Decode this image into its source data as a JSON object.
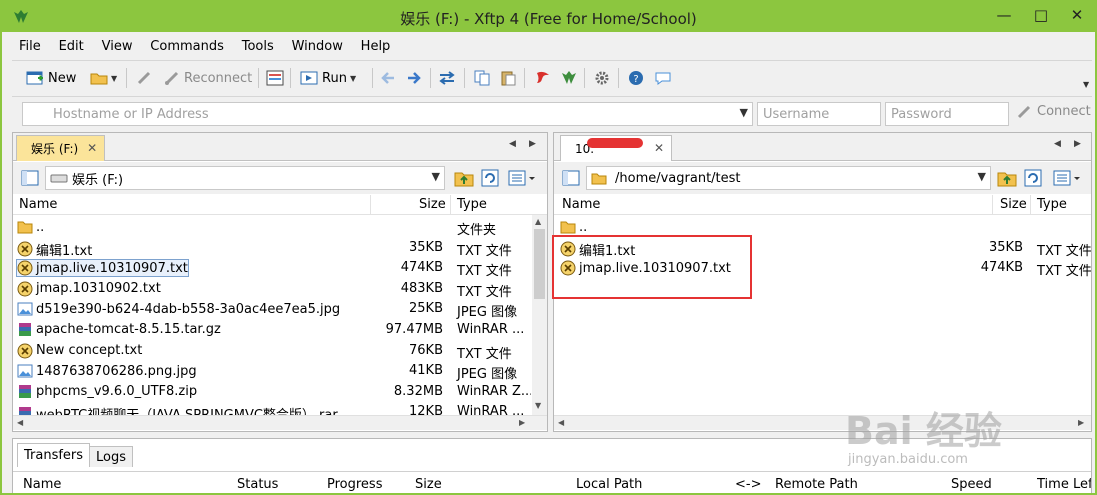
{
  "window": {
    "title": "娱乐 (F:) - Xftp 4 (Free for Home/School)",
    "minimize": "—",
    "maximize": "□",
    "close": "✕"
  },
  "menu": [
    "File",
    "Edit",
    "View",
    "Commands",
    "Tools",
    "Window",
    "Help"
  ],
  "toolbar": {
    "new_label": "New",
    "reconnect_label": "Reconnect",
    "run_label": "Run"
  },
  "address": {
    "host_placeholder": "Hostname or IP Address",
    "username_placeholder": "Username",
    "password_placeholder": "Password",
    "connect_label": "Connect"
  },
  "local": {
    "tab_label": "娱乐 (F:)",
    "path": "娱乐 (F:)",
    "columns": {
      "name": "Name",
      "size": "Size",
      "type": "Type"
    },
    "files": [
      {
        "name": "..",
        "size": "",
        "type": "文件夹",
        "icon": "folder-icon"
      },
      {
        "name": "编辑1.txt",
        "size": "35KB",
        "type": "TXT 文件",
        "icon": "txt-file-icon"
      },
      {
        "name": "jmap.live.10310907.txt",
        "size": "474KB",
        "type": "TXT 文件",
        "icon": "txt-file-icon"
      },
      {
        "name": "jmap.10310902.txt",
        "size": "483KB",
        "type": "TXT 文件",
        "icon": "txt-file-icon"
      },
      {
        "name": "d519e390-b624-4dab-b558-3a0ac4ee7ea5.jpg",
        "size": "25KB",
        "type": "JPEG 图像",
        "icon": "image-file-icon"
      },
      {
        "name": "apache-tomcat-8.5.15.tar.gz",
        "size": "97.47MB",
        "type": "WinRAR ...",
        "icon": "archive-file-icon"
      },
      {
        "name": "New concept.txt",
        "size": "76KB",
        "type": "TXT 文件",
        "icon": "txt-file-icon"
      },
      {
        "name": "1487638706286.png.jpg",
        "size": "41KB",
        "type": "JPEG 图像",
        "icon": "image-file-icon"
      },
      {
        "name": "phpcms_v9.6.0_UTF8.zip",
        "size": "8.32MB",
        "type": "WinRAR Z...",
        "icon": "archive-file-icon"
      },
      {
        "name": "webRTC视频聊天（JAVA SPRINGMVC整合版）.rar",
        "size": "12KB",
        "type": "WinRAR ...",
        "icon": "archive-file-icon"
      }
    ]
  },
  "remote": {
    "tab_label": "10.",
    "path": "/home/vagrant/test",
    "columns": {
      "name": "Name",
      "size": "Size",
      "type": "Type"
    },
    "files": [
      {
        "name": "..",
        "size": "",
        "type": "",
        "icon": "folder-icon"
      },
      {
        "name": "编辑1.txt",
        "size": "35KB",
        "type": "TXT 文件",
        "icon": "txt-file-icon"
      },
      {
        "name": "jmap.live.10310907.txt",
        "size": "474KB",
        "type": "TXT 文件",
        "icon": "txt-file-icon"
      }
    ]
  },
  "bottom": {
    "tabs": [
      "Transfers",
      "Logs"
    ],
    "columns": [
      "Name",
      "Status",
      "Progress",
      "Size",
      "Local Path",
      "<->",
      "Remote Path",
      "Speed",
      "Time Left"
    ]
  },
  "watermark": {
    "brand": "Bai 经验",
    "url": "jingyan.baidu.com"
  },
  "colors": {
    "titlebar": "#8cc63f",
    "active_tab": "#fbe49a",
    "highlight": "#e53333",
    "selection": "#7da2ce"
  }
}
